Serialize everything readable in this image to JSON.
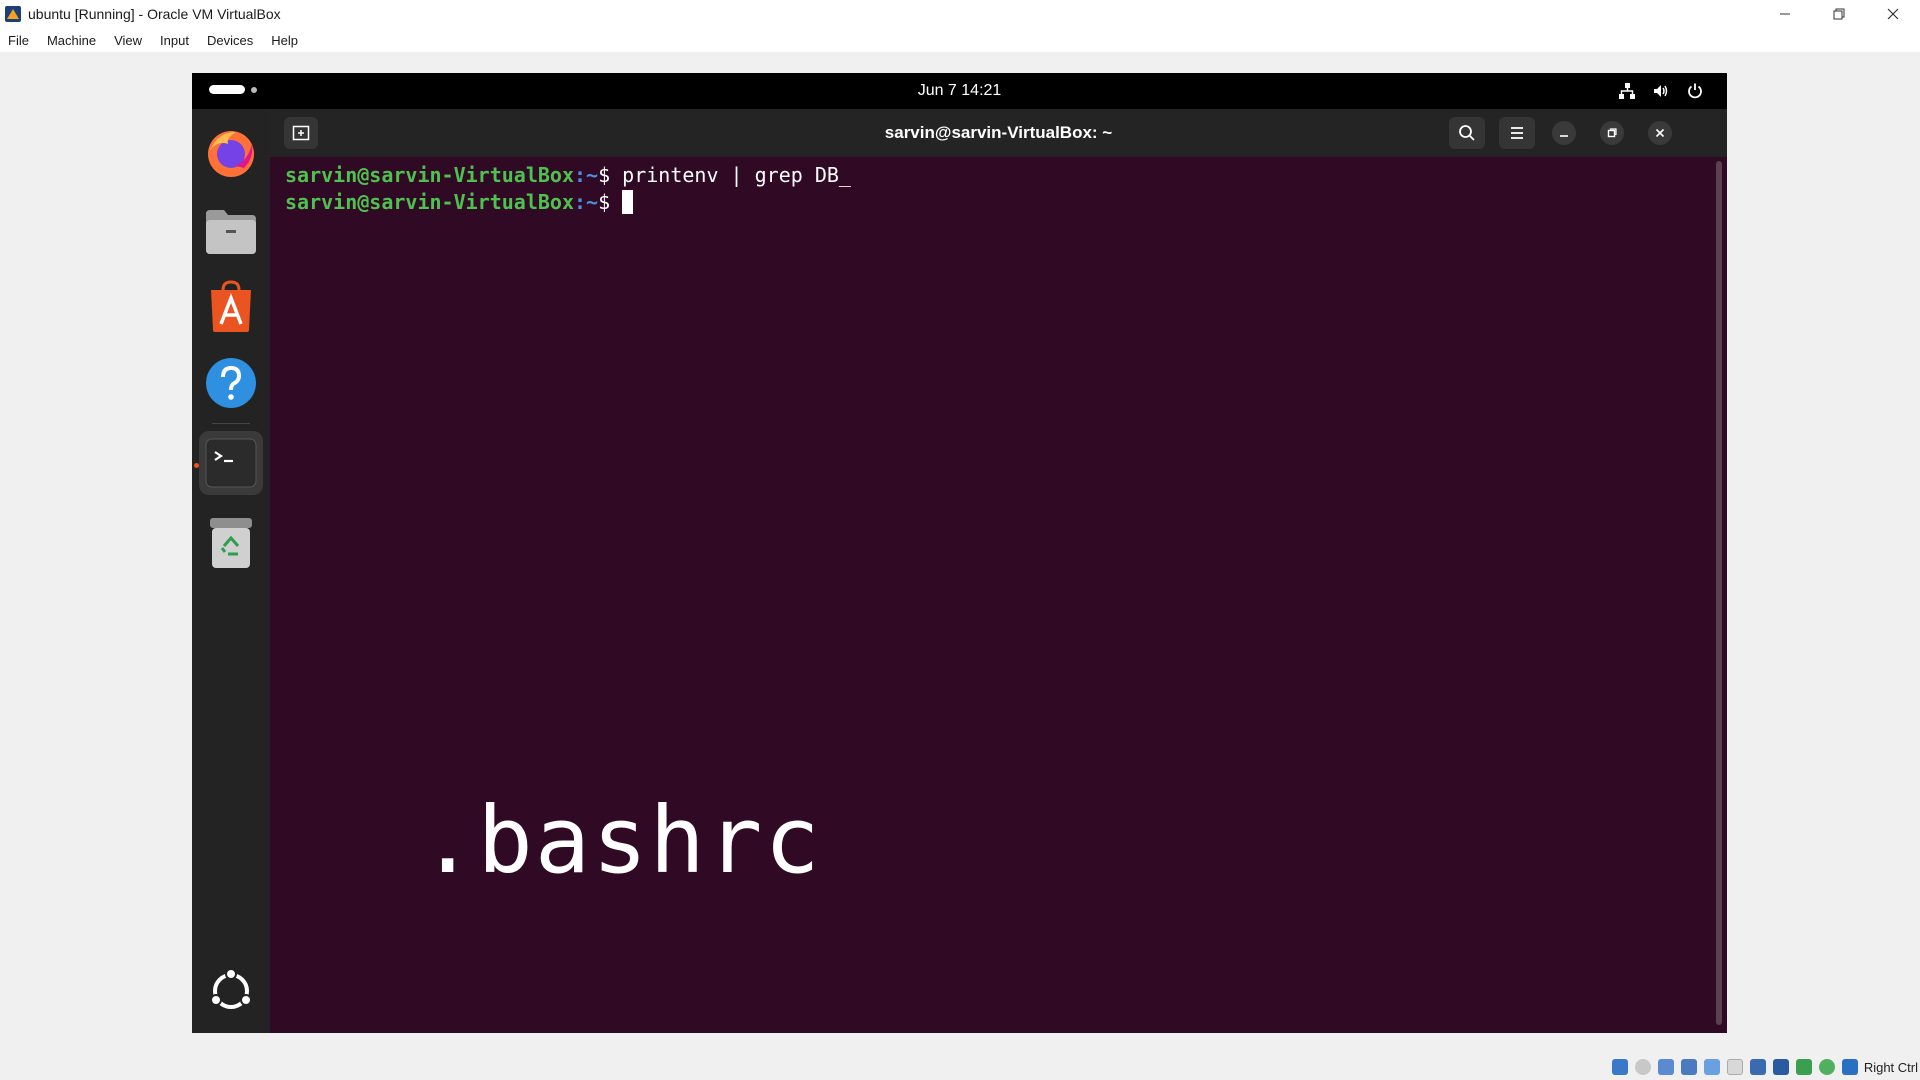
{
  "host": {
    "title": "ubuntu [Running] - Oracle VM VirtualBox",
    "menu": [
      "File",
      "Machine",
      "View",
      "Input",
      "Devices",
      "Help"
    ],
    "status_key": "Right Ctrl"
  },
  "guest": {
    "clock": "Jun 7  14:21",
    "terminal": {
      "title": "sarvin@sarvin-VirtualBox: ~",
      "lines": [
        {
          "user": "sarvin@sarvin-VirtualBox",
          "path": ":~",
          "symbol": "$ ",
          "command": "printenv | grep DB_"
        },
        {
          "user": "sarvin@sarvin-VirtualBox",
          "path": ":~",
          "symbol": "$ ",
          "command": ""
        }
      ]
    },
    "overlay": ".bashrc"
  },
  "colors": {
    "ubuntu_orange": "#e95420",
    "terminal_bg": "#300a24",
    "prompt_green": "#4ec24e",
    "prompt_blue": "#4a8fe0"
  },
  "icons": {
    "dock": [
      "firefox-icon",
      "files-icon",
      "app-center-icon",
      "help-icon",
      "terminal-icon",
      "trash-icon",
      "show-apps-icon"
    ],
    "tray": [
      "network-icon",
      "volume-icon",
      "power-icon"
    ]
  }
}
